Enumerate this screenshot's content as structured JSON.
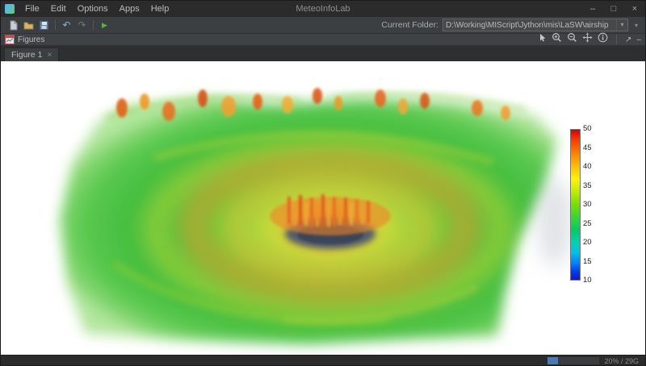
{
  "window": {
    "title": "MeteoInfoLab",
    "menu": [
      {
        "label": "File"
      },
      {
        "label": "Edit"
      },
      {
        "label": "Options"
      },
      {
        "label": "Apps"
      },
      {
        "label": "Help"
      }
    ],
    "controls": {
      "minimize": "–",
      "maximize": "□",
      "close": "×"
    }
  },
  "toolbar": {
    "current_folder_label": "Current Folder:",
    "current_folder_value": "D:\\Working\\MIScript\\Jython\\mis\\LaSW\\airship"
  },
  "icons": {
    "undo": "↶",
    "redo": "↷",
    "run": "▶",
    "combo_arrow": "▾",
    "overflow": "▾",
    "float": "↗",
    "min_panel": "–"
  },
  "figures_panel": {
    "title": "Figures",
    "tab": {
      "label": "Figure 1",
      "close": "×"
    }
  },
  "chart_data": {
    "type": "volume-3d",
    "description": "3D volume rendering of a tropical cyclone cloud field viewed obliquely: green-yellow cloud deck, orange eyewall ring with convective towers, dark blue-gray eye at center, scattered orange convection along the far edge",
    "colorbar": {
      "min": 10,
      "max": 50,
      "ticks": [
        50,
        45,
        40,
        35,
        30,
        25,
        20,
        15,
        10
      ],
      "colors_top_to_bottom": [
        "#d40000",
        "#ff8c00",
        "#fff400",
        "#7ee000",
        "#38d830",
        "#00cc66",
        "#00c0e8",
        "#0080ff",
        "#1818c0"
      ]
    }
  },
  "statusbar": {
    "memory": "20% / 29G"
  }
}
